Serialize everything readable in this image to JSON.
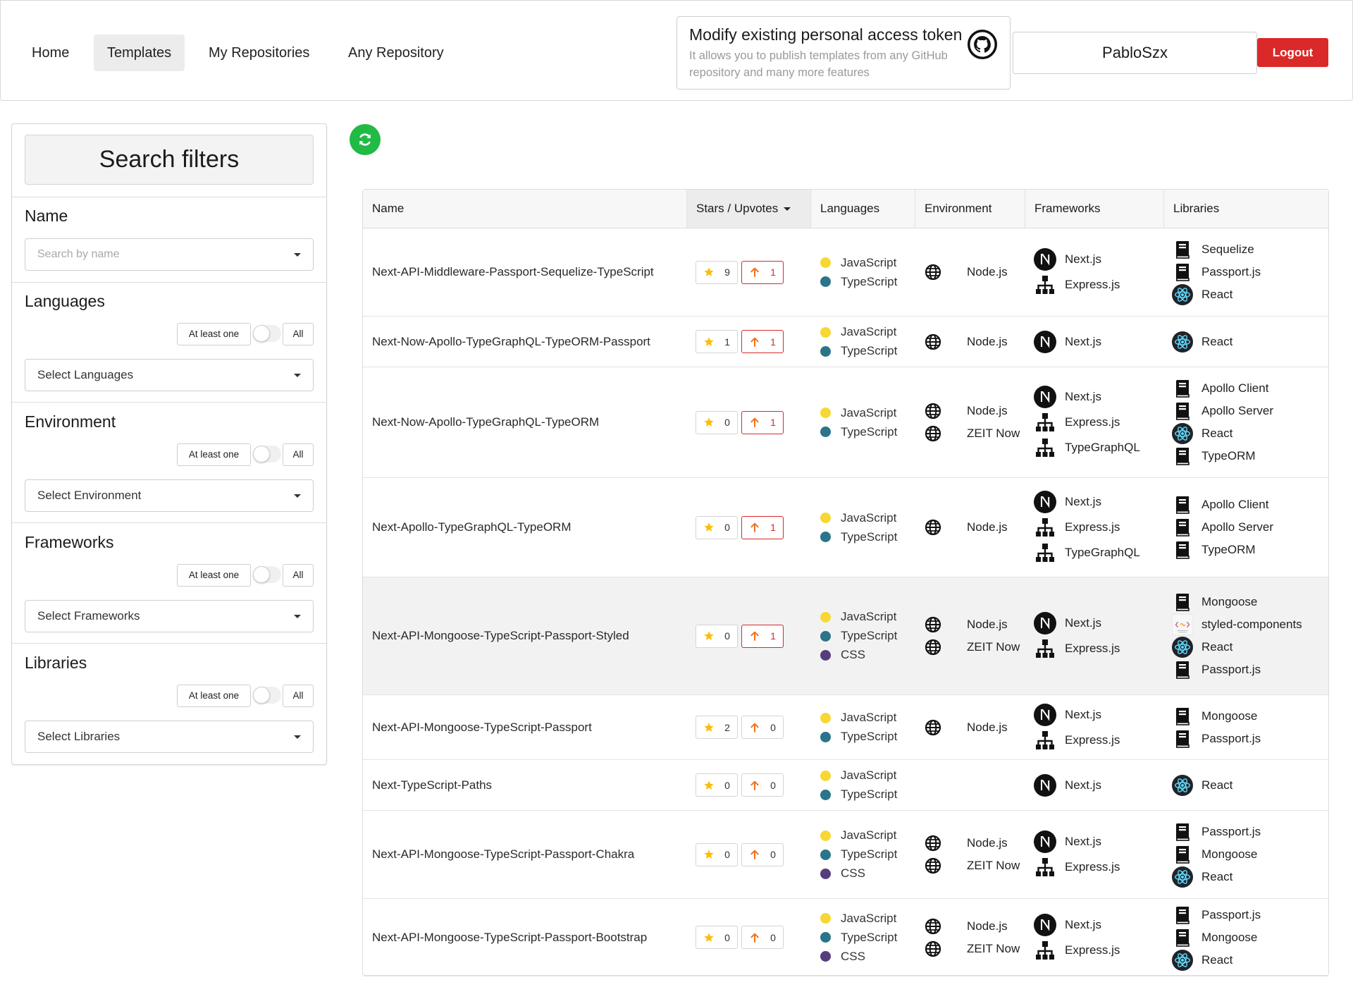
{
  "nav": {
    "items": [
      "Home",
      "Templates",
      "My Repositories",
      "Any Repository"
    ],
    "active": "Templates"
  },
  "token": {
    "title": "Modify existing personal access token",
    "description": "It allows you to publish templates from any GitHub repository and many more features"
  },
  "user": {
    "name": "PabloSzx",
    "logout_label": "Logout"
  },
  "sidebar": {
    "title": "Search filters",
    "name_filter": {
      "title": "Name",
      "placeholder": "Search by name"
    },
    "filters": [
      {
        "title": "Languages",
        "at_least_one": "At least one",
        "all": "All",
        "select": "Select Languages"
      },
      {
        "title": "Environment",
        "at_least_one": "At least one",
        "all": "All",
        "select": "Select Environment"
      },
      {
        "title": "Frameworks",
        "at_least_one": "At least one",
        "all": "All",
        "select": "Select Frameworks"
      },
      {
        "title": "Libraries",
        "at_least_one": "At least one",
        "all": "All",
        "select": "Select Libraries"
      }
    ]
  },
  "table": {
    "headers": {
      "name": "Name",
      "stars": "Stars / Upvotes",
      "languages": "Languages",
      "environment": "Environment",
      "frameworks": "Frameworks",
      "libraries": "Libraries"
    },
    "rows": [
      {
        "name": "Next-API-Middleware-Passport-Sequelize-TypeScript",
        "stars": 9,
        "upvotes": 1,
        "upvoted": true,
        "languages": [
          "JavaScript",
          "TypeScript"
        ],
        "environment": [
          "Node.js"
        ],
        "frameworks": [
          {
            "name": "Next.js",
            "icon": "nextjs-icon"
          },
          {
            "name": "Express.js",
            "icon": "sitemap-icon"
          }
        ],
        "libraries": [
          {
            "name": "Sequelize",
            "icon": "book-icon"
          },
          {
            "name": "Passport.js",
            "icon": "book-icon"
          },
          {
            "name": "React",
            "icon": "react-icon"
          }
        ]
      },
      {
        "name": "Next-Now-Apollo-TypeGraphQL-TypeORM-Passport",
        "stars": 1,
        "upvotes": 1,
        "upvoted": true,
        "languages": [
          "JavaScript",
          "TypeScript"
        ],
        "environment": [
          "Node.js"
        ],
        "frameworks": [
          {
            "name": "Next.js",
            "icon": "nextjs-icon"
          }
        ],
        "libraries": [
          {
            "name": "React",
            "icon": "react-icon"
          }
        ]
      },
      {
        "name": "Next-Now-Apollo-TypeGraphQL-TypeORM",
        "stars": 0,
        "upvotes": 1,
        "upvoted": true,
        "languages": [
          "JavaScript",
          "TypeScript"
        ],
        "environment": [
          "Node.js",
          "ZEIT Now"
        ],
        "frameworks": [
          {
            "name": "Next.js",
            "icon": "nextjs-icon"
          },
          {
            "name": "Express.js",
            "icon": "sitemap-icon"
          },
          {
            "name": "TypeGraphQL",
            "icon": "sitemap-icon"
          }
        ],
        "libraries": [
          {
            "name": "Apollo Client",
            "icon": "book-icon"
          },
          {
            "name": "Apollo Server",
            "icon": "book-icon"
          },
          {
            "name": "React",
            "icon": "react-icon"
          },
          {
            "name": "TypeORM",
            "icon": "book-icon"
          }
        ]
      },
      {
        "name": "Next-Apollo-TypeGraphQL-TypeORM",
        "stars": 0,
        "upvotes": 1,
        "upvoted": true,
        "languages": [
          "JavaScript",
          "TypeScript"
        ],
        "environment": [
          "Node.js"
        ],
        "frameworks": [
          {
            "name": "Next.js",
            "icon": "nextjs-icon"
          },
          {
            "name": "Express.js",
            "icon": "sitemap-icon"
          },
          {
            "name": "TypeGraphQL",
            "icon": "sitemap-icon"
          }
        ],
        "libraries": [
          {
            "name": "Apollo Client",
            "icon": "book-icon"
          },
          {
            "name": "Apollo Server",
            "icon": "book-icon"
          },
          {
            "name": "TypeORM",
            "icon": "book-icon"
          }
        ]
      },
      {
        "name": "Next-API-Mongoose-TypeScript-Passport-Styled",
        "stars": 0,
        "upvotes": 1,
        "upvoted": true,
        "hover": true,
        "languages": [
          "JavaScript",
          "TypeScript",
          "CSS"
        ],
        "environment": [
          "Node.js",
          "ZEIT Now"
        ],
        "frameworks": [
          {
            "name": "Next.js",
            "icon": "nextjs-icon"
          },
          {
            "name": "Express.js",
            "icon": "sitemap-icon"
          }
        ],
        "libraries": [
          {
            "name": "Mongoose",
            "icon": "book-icon"
          },
          {
            "name": "styled-components",
            "icon": "styled-components-icon"
          },
          {
            "name": "React",
            "icon": "react-icon"
          },
          {
            "name": "Passport.js",
            "icon": "book-icon"
          }
        ]
      },
      {
        "name": "Next-API-Mongoose-TypeScript-Passport",
        "stars": 2,
        "upvotes": 0,
        "upvoted": false,
        "languages": [
          "JavaScript",
          "TypeScript"
        ],
        "environment": [
          "Node.js"
        ],
        "frameworks": [
          {
            "name": "Next.js",
            "icon": "nextjs-icon"
          },
          {
            "name": "Express.js",
            "icon": "sitemap-icon"
          }
        ],
        "libraries": [
          {
            "name": "Mongoose",
            "icon": "book-icon"
          },
          {
            "name": "Passport.js",
            "icon": "book-icon"
          }
        ]
      },
      {
        "name": "Next-TypeScript-Paths",
        "stars": 0,
        "upvotes": 0,
        "upvoted": false,
        "languages": [
          "JavaScript",
          "TypeScript"
        ],
        "environment": [],
        "frameworks": [
          {
            "name": "Next.js",
            "icon": "nextjs-icon"
          }
        ],
        "libraries": [
          {
            "name": "React",
            "icon": "react-icon"
          }
        ]
      },
      {
        "name": "Next-API-Mongoose-TypeScript-Passport-Chakra",
        "stars": 0,
        "upvotes": 0,
        "upvoted": false,
        "languages": [
          "JavaScript",
          "TypeScript",
          "CSS"
        ],
        "environment": [
          "Node.js",
          "ZEIT Now"
        ],
        "frameworks": [
          {
            "name": "Next.js",
            "icon": "nextjs-icon"
          },
          {
            "name": "Express.js",
            "icon": "sitemap-icon"
          }
        ],
        "libraries": [
          {
            "name": "Passport.js",
            "icon": "book-icon"
          },
          {
            "name": "Mongoose",
            "icon": "book-icon"
          },
          {
            "name": "React",
            "icon": "react-icon"
          }
        ]
      },
      {
        "name": "Next-API-Mongoose-TypeScript-Passport-Bootstrap",
        "stars": 0,
        "upvotes": 0,
        "upvoted": false,
        "languages": [
          "JavaScript",
          "TypeScript",
          "CSS"
        ],
        "environment": [
          "Node.js",
          "ZEIT Now"
        ],
        "frameworks": [
          {
            "name": "Next.js",
            "icon": "nextjs-icon"
          },
          {
            "name": "Express.js",
            "icon": "sitemap-icon"
          }
        ],
        "libraries": [
          {
            "name": "Passport.js",
            "icon": "book-icon"
          },
          {
            "name": "Mongoose",
            "icon": "book-icon"
          },
          {
            "name": "React",
            "icon": "react-icon"
          }
        ]
      }
    ]
  },
  "colors": {
    "JavaScript": "#f7d733",
    "TypeScript": "#2b7489",
    "CSS": "#563d7c",
    "danger": "#db2828",
    "success": "#21ba45",
    "star": "#fbbd08",
    "upvote": "#f2711c"
  },
  "icons": {
    "github": "github-icon",
    "refresh": "refresh-icon",
    "environment": "globe-icon",
    "star": "star-icon",
    "upvote": "arrow-up-icon"
  }
}
